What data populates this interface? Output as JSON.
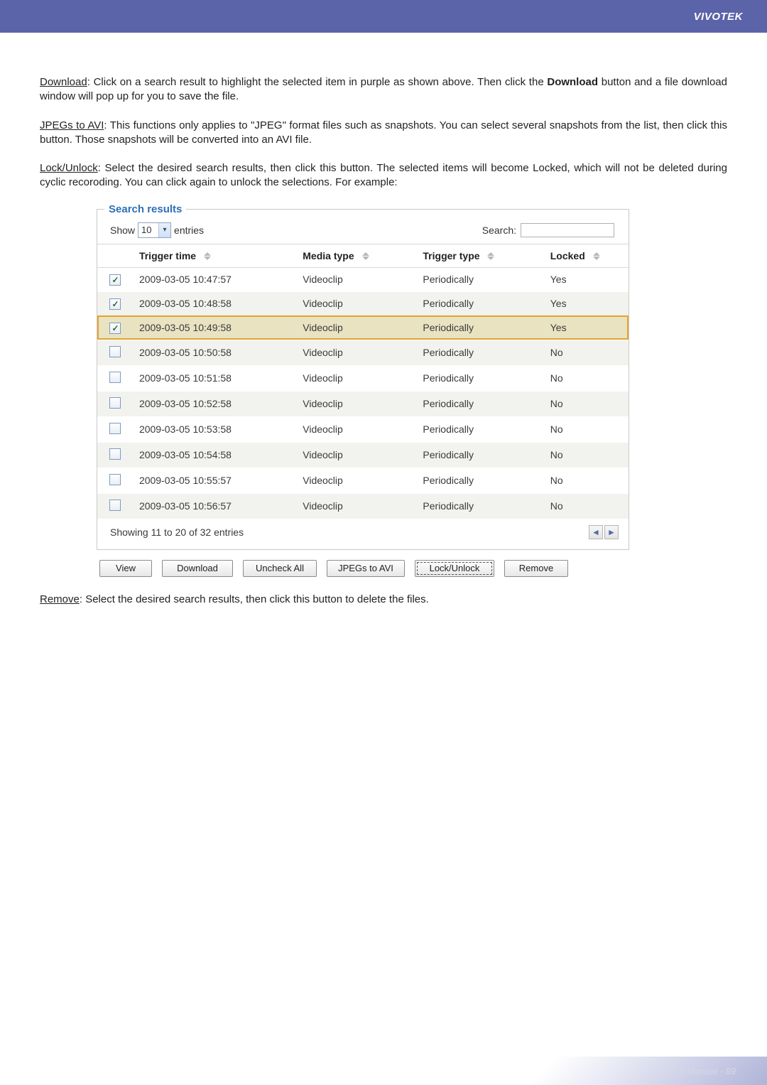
{
  "header": {
    "brand": "VIVOTEK"
  },
  "paragraphs": {
    "p1a": "Download",
    "p1b": ": Click on a search result to highlight the selected item in purple as shown above. Then click the ",
    "p1c": "Download",
    "p1d": " button and a file download window will pop up for you to save the file.",
    "p2a": "JPEGs to AVI",
    "p2b": ": This functions only applies to \"JPEG\" format files such as snapshots. You can select several snapshots from the list, then click this button. Those snapshots will be converted into an AVI file.",
    "p3a": "Lock/Unlock",
    "p3b": ": Select the desired search results, then click this button. The selected items will become Locked, which will not be deleted during cyclic recoroding. You can click again to unlock the selections. For example:",
    "p4a": "Remove",
    "p4b": ": Select the desired search results, then click this button to delete the files."
  },
  "panel": {
    "legend": "Search results",
    "show_label": "Show",
    "entries_value": "10",
    "entries_label": "entries",
    "search_label": "Search:",
    "columns": {
      "trigger_time": "Trigger time",
      "media_type": "Media type",
      "trigger_type": "Trigger type",
      "locked": "Locked"
    },
    "rows": [
      {
        "checked": true,
        "selected": false,
        "time": "2009-03-05 10:47:57",
        "media": "Videoclip",
        "trigger": "Periodically",
        "locked": "Yes"
      },
      {
        "checked": true,
        "selected": false,
        "time": "2009-03-05 10:48:58",
        "media": "Videoclip",
        "trigger": "Periodically",
        "locked": "Yes"
      },
      {
        "checked": true,
        "selected": true,
        "time": "2009-03-05 10:49:58",
        "media": "Videoclip",
        "trigger": "Periodically",
        "locked": "Yes"
      },
      {
        "checked": false,
        "selected": false,
        "time": "2009-03-05 10:50:58",
        "media": "Videoclip",
        "trigger": "Periodically",
        "locked": "No"
      },
      {
        "checked": false,
        "selected": false,
        "time": "2009-03-05 10:51:58",
        "media": "Videoclip",
        "trigger": "Periodically",
        "locked": "No"
      },
      {
        "checked": false,
        "selected": false,
        "time": "2009-03-05 10:52:58",
        "media": "Videoclip",
        "trigger": "Periodically",
        "locked": "No"
      },
      {
        "checked": false,
        "selected": false,
        "time": "2009-03-05 10:53:58",
        "media": "Videoclip",
        "trigger": "Periodically",
        "locked": "No"
      },
      {
        "checked": false,
        "selected": false,
        "time": "2009-03-05 10:54:58",
        "media": "Videoclip",
        "trigger": "Periodically",
        "locked": "No"
      },
      {
        "checked": false,
        "selected": false,
        "time": "2009-03-05 10:55:57",
        "media": "Videoclip",
        "trigger": "Periodically",
        "locked": "No"
      },
      {
        "checked": false,
        "selected": false,
        "time": "2009-03-05 10:56:57",
        "media": "Videoclip",
        "trigger": "Periodically",
        "locked": "No"
      }
    ],
    "footer_status": "Showing 11 to 20 of 32 entries",
    "buttons": {
      "view": "View",
      "download": "Download",
      "uncheck_all": "Uncheck All",
      "jpegs_to_avi": "JPEGs to AVI",
      "lock_unlock": "Lock/Unlock",
      "remove": "Remove"
    }
  },
  "footer": {
    "text": "User's Manual - 89"
  }
}
